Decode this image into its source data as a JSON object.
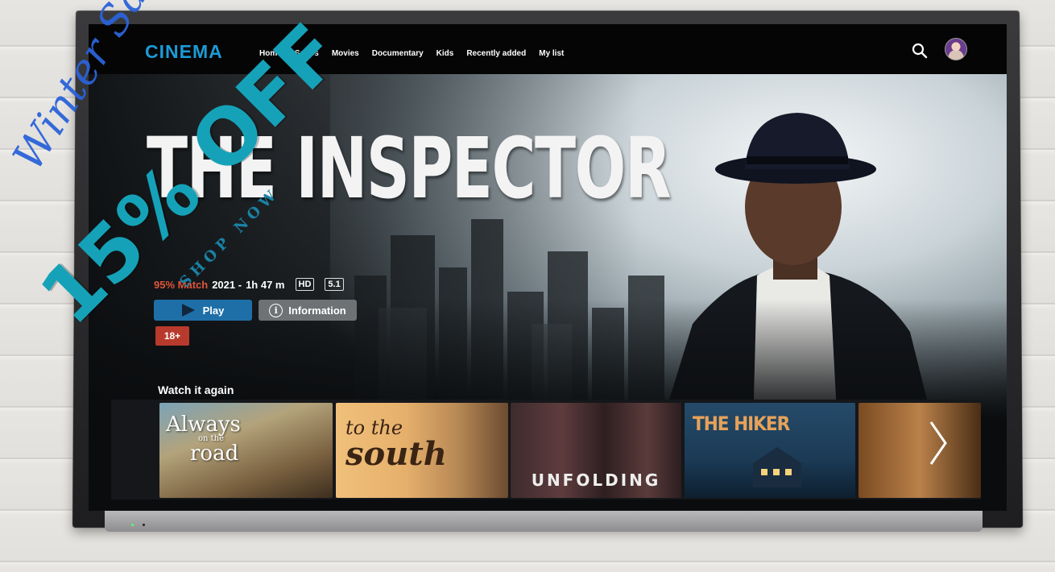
{
  "app": {
    "logo": "CINEMA"
  },
  "nav": {
    "items": [
      "Home",
      "Series",
      "Movies",
      "Documentary",
      "Kids",
      "Recently added",
      "My list"
    ]
  },
  "header_icons": {
    "search": "search-icon",
    "profile": "avatar"
  },
  "hero": {
    "title": "THE INSPECTOR",
    "match": "95% Match",
    "year": "2021 -",
    "duration": "1h 47 m",
    "quality_badge": "HD",
    "audio_badge": "5.1",
    "play_label": "Play",
    "info_label": "Information",
    "age_rating": "18+"
  },
  "row": {
    "title": "Watch it again",
    "tiles": [
      {
        "title_line1": "Always",
        "title_small": "on the",
        "title_line2": "road"
      },
      {
        "title_line1": "to the",
        "title_line2": "south"
      },
      {
        "title": "UNFOLDING"
      },
      {
        "title": "THE HIKER"
      },
      {
        "title": ""
      }
    ]
  },
  "promo": {
    "script": "Winter Sales",
    "discount": "15% OFF",
    "cta": "SHOP NOW"
  },
  "colors": {
    "logo": "#1c9ad6",
    "match": "#e0553a",
    "play_button": "#1e6fa8",
    "info_button": "#6e7275",
    "age_badge": "#b83a2d",
    "promo_script": "#2b63d8",
    "promo_discount": "#15a2b8"
  }
}
